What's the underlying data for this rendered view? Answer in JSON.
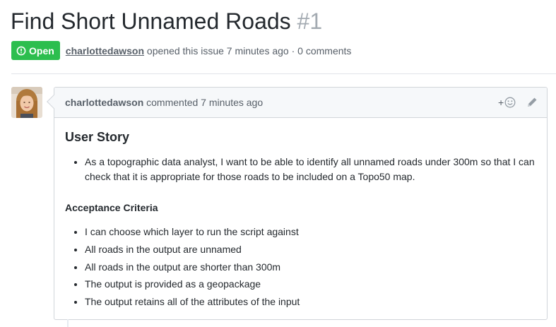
{
  "issue": {
    "title": "Find Short Unnamed Roads",
    "number": "#1",
    "state": "Open",
    "author": "charlottedawson",
    "meta": "opened this issue 7 minutes ago · 0 comments"
  },
  "comment": {
    "author": "charlottedawson",
    "action": "commented 7 minutes ago",
    "reaction_plus": "+",
    "body": {
      "story_heading": "User Story",
      "story_items": [
        "As a topographic data analyst, I want to be able to identify all unnamed roads under 300m so that I can check that it is appropriate for those roads to be included on a Topo50 map."
      ],
      "criteria_heading": "Acceptance Criteria",
      "criteria_items": [
        "I can choose which layer to run the script against",
        "All roads in the output are unnamed",
        "All roads in the output are shorter than 300m",
        "The output is provided as a geopackage",
        "The output retains all of the attributes of the input"
      ]
    }
  },
  "icons": {
    "state": "issue-opened-icon",
    "reaction": "smiley-icon",
    "edit": "pencil-icon",
    "avatar": "avatar"
  },
  "colors": {
    "open_green": "#2cbe4e",
    "muted_text": "#586069",
    "number_gray": "#a3aab1",
    "header_bg": "#f6f8fa",
    "border": "#d1d5da"
  }
}
